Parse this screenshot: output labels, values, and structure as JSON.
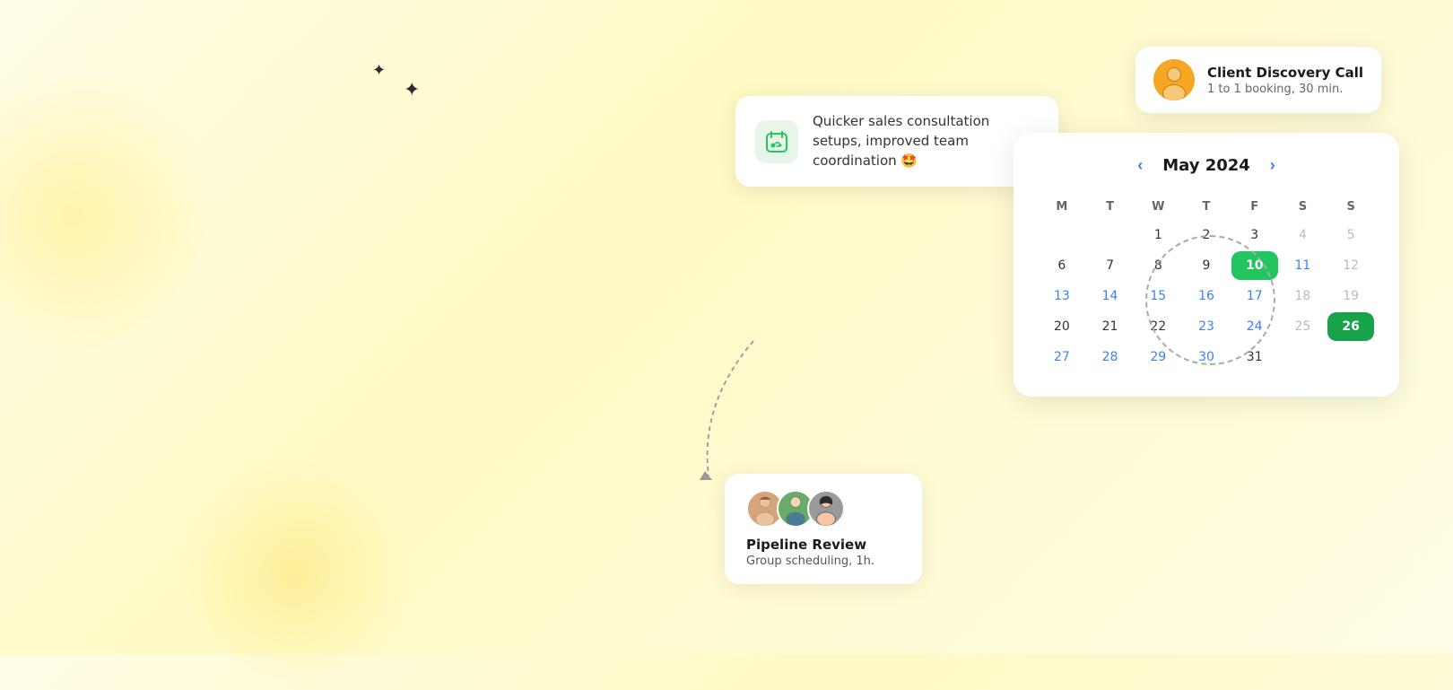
{
  "background": {
    "color": "#fffde7"
  },
  "sparkles": [
    {
      "label": "✦",
      "class": "sparkle-1"
    },
    {
      "label": "✦",
      "class": "sparkle-2"
    }
  ],
  "notification": {
    "icon": "🗓️",
    "text": "Quicker sales consultation setups, improved team coordination 🤩"
  },
  "discovery_card": {
    "title": "Client Discovery Call",
    "subtitle": "1 to 1 booking, 30 min."
  },
  "calendar": {
    "month_label": "May 2024",
    "prev_label": "‹",
    "next_label": "›",
    "day_headers": [
      "M",
      "T",
      "W",
      "T",
      "F",
      "S",
      "S"
    ],
    "weeks": [
      [
        {
          "day": "",
          "state": "empty"
        },
        {
          "day": "",
          "state": "empty"
        },
        {
          "day": "1",
          "state": "normal"
        },
        {
          "day": "2",
          "state": "normal"
        },
        {
          "day": "3",
          "state": "normal"
        },
        {
          "day": "4",
          "state": "muted"
        },
        {
          "day": "5",
          "state": "muted"
        }
      ],
      [
        {
          "day": "6",
          "state": "normal"
        },
        {
          "day": "7",
          "state": "normal"
        },
        {
          "day": "8",
          "state": "normal"
        },
        {
          "day": "9",
          "state": "normal"
        },
        {
          "day": "10",
          "state": "selected-green"
        },
        {
          "day": "11",
          "state": "clickable"
        },
        {
          "day": "12",
          "state": "muted"
        }
      ],
      [
        {
          "day": "13",
          "state": "clickable"
        },
        {
          "day": "14",
          "state": "clickable"
        },
        {
          "day": "15",
          "state": "clickable"
        },
        {
          "day": "16",
          "state": "clickable"
        },
        {
          "day": "17",
          "state": "clickable"
        },
        {
          "day": "18",
          "state": "muted"
        },
        {
          "day": "19",
          "state": "muted"
        }
      ],
      [
        {
          "day": "20",
          "state": "normal"
        },
        {
          "day": "21",
          "state": "normal"
        },
        {
          "day": "22",
          "state": "normal"
        },
        {
          "day": "23",
          "state": "clickable"
        },
        {
          "day": "24",
          "state": "clickable"
        },
        {
          "day": "25",
          "state": "muted"
        },
        {
          "day": "26",
          "state": "selected-green-dark"
        }
      ],
      [
        {
          "day": "27",
          "state": "clickable"
        },
        {
          "day": "28",
          "state": "clickable"
        },
        {
          "day": "29",
          "state": "clickable"
        },
        {
          "day": "30",
          "state": "clickable"
        },
        {
          "day": "31",
          "state": "normal"
        },
        {
          "day": "",
          "state": "empty"
        },
        {
          "day": "",
          "state": "empty"
        }
      ]
    ]
  },
  "pipeline": {
    "title": "Pipeline Review",
    "subtitle": "Group scheduling, 1h."
  }
}
